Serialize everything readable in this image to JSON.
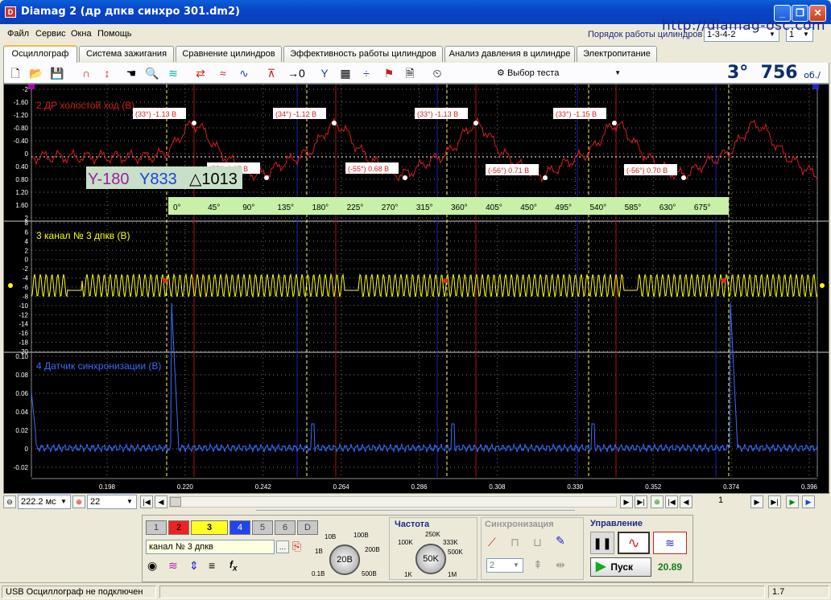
{
  "window": {
    "title": "Diamag 2 (др дпкв синхро 301.dm2)",
    "logo_text": "D"
  },
  "menu": [
    "Файл",
    "Сервис",
    "Окна",
    "Помощь"
  ],
  "watermark": "http://diamag-osc.com",
  "cyl_order": {
    "label": "Порядок работы цилиндров",
    "value": "1-3-4-2",
    "cyl": "1"
  },
  "tabs": [
    "Осциллограф",
    "Система зажигания",
    "Сравнение цилиндров",
    "Эффективность работы цилиндров",
    "Анализ давления в цилиндре",
    "Электропитание"
  ],
  "active_tab": 0,
  "toolbar": {
    "select_test": "Выбор теста",
    "rpm_deg": "3°",
    "rpm_val": "756",
    "rpm_unit": "об./мин."
  },
  "colors": {
    "ch2": "#d81e1e",
    "ch3": "#ffff00",
    "ch4": "#3a6cff",
    "grid": "#7a7a7a",
    "cursor": "#ffff66"
  },
  "scope": {
    "pane2": {
      "title": "2 ДР холостой ход (В)",
      "yticks": [
        "-2",
        "-1.60",
        "-1.20",
        "-0.80",
        "-0.40",
        "0",
        "0.40",
        "0.80",
        "1.20",
        "1.60",
        "2"
      ],
      "max_labels": [
        "(33°) -1.13 В",
        "(34°) -1.12 В",
        "(33°) -1.13 В",
        "(33°) -1.15 В"
      ],
      "min_labels": [
        "(55°) 0.67 В",
        "(-55°) 0.68 В",
        "(-56°) 0.71 В",
        "(-56°) 0.70 В"
      ],
      "cursor_a": "-180",
      "cursor_b": "833",
      "delta": "1013",
      "degree_ticks": [
        "0°",
        "45°",
        "90°",
        "135°",
        "180°",
        "225°",
        "270°",
        "315°",
        "360°",
        "405°",
        "450°",
        "495°",
        "540°",
        "585°",
        "630°",
        "675°"
      ]
    },
    "pane3": {
      "title": "3 канал № 3 дпкв (В)",
      "yticks": [
        "8",
        "6",
        "4",
        "2",
        "0",
        "-2",
        "-4",
        "-6",
        "-8",
        "-10",
        "-12",
        "-14",
        "-16",
        "-18",
        "-20"
      ]
    },
    "pane4": {
      "title": "4 Датчик синхронизации (В)",
      "yticks": [
        "0.10",
        "0.08",
        "0.06",
        "0.04",
        "0.02",
        "0",
        "-0.02"
      ]
    },
    "xticks": [
      "0.198",
      "0.220",
      "0.242",
      "0.264",
      "0.286",
      "0.308",
      "0.330",
      "0.352",
      "0.374",
      "0.396"
    ]
  },
  "nav": {
    "timebase": "222.2 мс",
    "zoom": "22",
    "frame": "1"
  },
  "channels": {
    "buttons": [
      "1",
      "2",
      "3",
      "4",
      "5",
      "6",
      "D"
    ],
    "selected_name": "канал № 3 дпкв"
  },
  "voltage": {
    "center": "20В",
    "labels": [
      "10В",
      "100В",
      "1В",
      "200В",
      "0.1В",
      "500В"
    ]
  },
  "freq": {
    "title": "Частота",
    "center": "50K",
    "labels": [
      "250K",
      "100K",
      "333K",
      "500K",
      "1K",
      "1M"
    ]
  },
  "sync": {
    "title": "Синхронизация",
    "value": "2"
  },
  "control": {
    "title": "Управление",
    "start": "Пуск",
    "counter": "20.89"
  },
  "status": {
    "text": "USB Осциллограф не подключен",
    "version": "1.7"
  }
}
